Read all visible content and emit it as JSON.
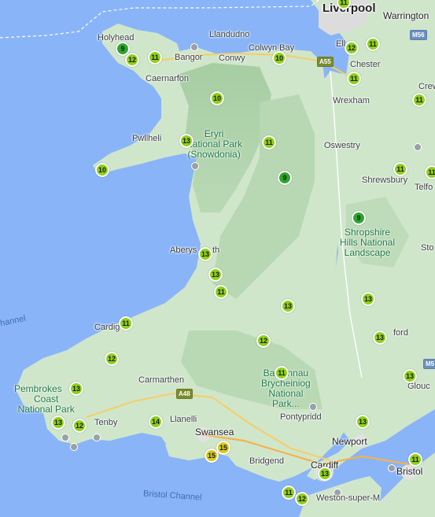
{
  "colors": {
    "sea": "#8ab4f8",
    "land": "#cfe6cb",
    "upland": "#a9cfa5",
    "marker_9": "#2fa52f",
    "marker_10_14": "#8fd11a",
    "marker_15": "#d8cc14"
  },
  "places": {
    "liverpool": "Liverpool",
    "warrington": "Warrington",
    "holyhead": "Holyhead",
    "llandudno": "Llandudno",
    "colwyn_bay": "Colwyn Bay",
    "bangor": "Bangor",
    "conwy": "Conwy",
    "ellesmere": "Ell",
    "chester": "Chester",
    "crewe": "Crew",
    "caernarfon": "Caernarfon",
    "wrexham": "Wrexham",
    "pwllheli": "Pwllheli",
    "oswestry": "Oswestry",
    "shrewsbury": "Shrewsbury",
    "telford": "Telfo",
    "aberystwyth_a": "Aberys",
    "aberystwyth_b": "th",
    "stokesay": "Sto",
    "cardigan": "Cardig",
    "hereford": "ford",
    "carmarthen": "Carmarthen",
    "tenby": "Tenby",
    "llanelli": "Llanelli",
    "swansea": "Swansea",
    "pontypridd": "Pontypridd",
    "newport": "Newport",
    "gloucester": "Glouc",
    "bridgend": "Bridgend",
    "cardiff": "Cardiff",
    "bristol": "Bristol",
    "weston": "Weston-super-M"
  },
  "parks": {
    "eryri": [
      "Eryri",
      "National Park",
      "(Snowdonia)"
    ],
    "shropshire": [
      "Shropshire",
      "Hills National",
      "Landscape"
    ],
    "pembrokeshire": [
      "Pembrokes",
      "e",
      "Coast",
      "National Park"
    ],
    "bannau": [
      "Ba",
      "nnau",
      "Brycheiniog",
      "National",
      "Park..."
    ]
  },
  "water": {
    "bristol_channel": "Bristol Channel",
    "channel_fragment": "hannel"
  },
  "roads": [
    "A55",
    "A48",
    "M56",
    "M5"
  ],
  "markers": [
    {
      "label": "11",
      "tier": "b"
    },
    {
      "label": "9",
      "tier": "a"
    },
    {
      "label": "12",
      "tier": "b"
    },
    {
      "label": "11",
      "tier": "b"
    },
    {
      "label": "10",
      "tier": "b"
    },
    {
      "label": "12",
      "tier": "b"
    },
    {
      "label": "11",
      "tier": "b"
    },
    {
      "label": "11",
      "tier": "b"
    },
    {
      "label": "10",
      "tier": "b"
    },
    {
      "label": "11",
      "tier": "b"
    },
    {
      "label": "13",
      "tier": "b"
    },
    {
      "label": "11",
      "tier": "b"
    },
    {
      "label": "10",
      "tier": "b"
    },
    {
      "label": "9",
      "tier": "a"
    },
    {
      "label": "11",
      "tier": "b"
    },
    {
      "label": "11",
      "tier": "b"
    },
    {
      "label": "9",
      "tier": "a"
    },
    {
      "label": "13",
      "tier": "b"
    },
    {
      "label": "13",
      "tier": "b"
    },
    {
      "label": "11",
      "tier": "b"
    },
    {
      "label": "13",
      "tier": "b"
    },
    {
      "label": "13",
      "tier": "b"
    },
    {
      "label": "11",
      "tier": "b"
    },
    {
      "label": "12",
      "tier": "b"
    },
    {
      "label": "12",
      "tier": "b"
    },
    {
      "label": "13",
      "tier": "b"
    },
    {
      "label": "11",
      "tier": "b"
    },
    {
      "label": "13",
      "tier": "b"
    },
    {
      "label": "13",
      "tier": "b"
    },
    {
      "label": "12",
      "tier": "b"
    },
    {
      "label": "14",
      "tier": "b"
    },
    {
      "label": "13",
      "tier": "b"
    },
    {
      "label": "15",
      "tier": "c"
    },
    {
      "label": "15",
      "tier": "c"
    },
    {
      "label": "13",
      "tier": "b"
    },
    {
      "label": "13",
      "tier": "b"
    },
    {
      "label": "11",
      "tier": "b"
    },
    {
      "label": "11",
      "tier": "b"
    },
    {
      "label": "12",
      "tier": "b"
    }
  ]
}
